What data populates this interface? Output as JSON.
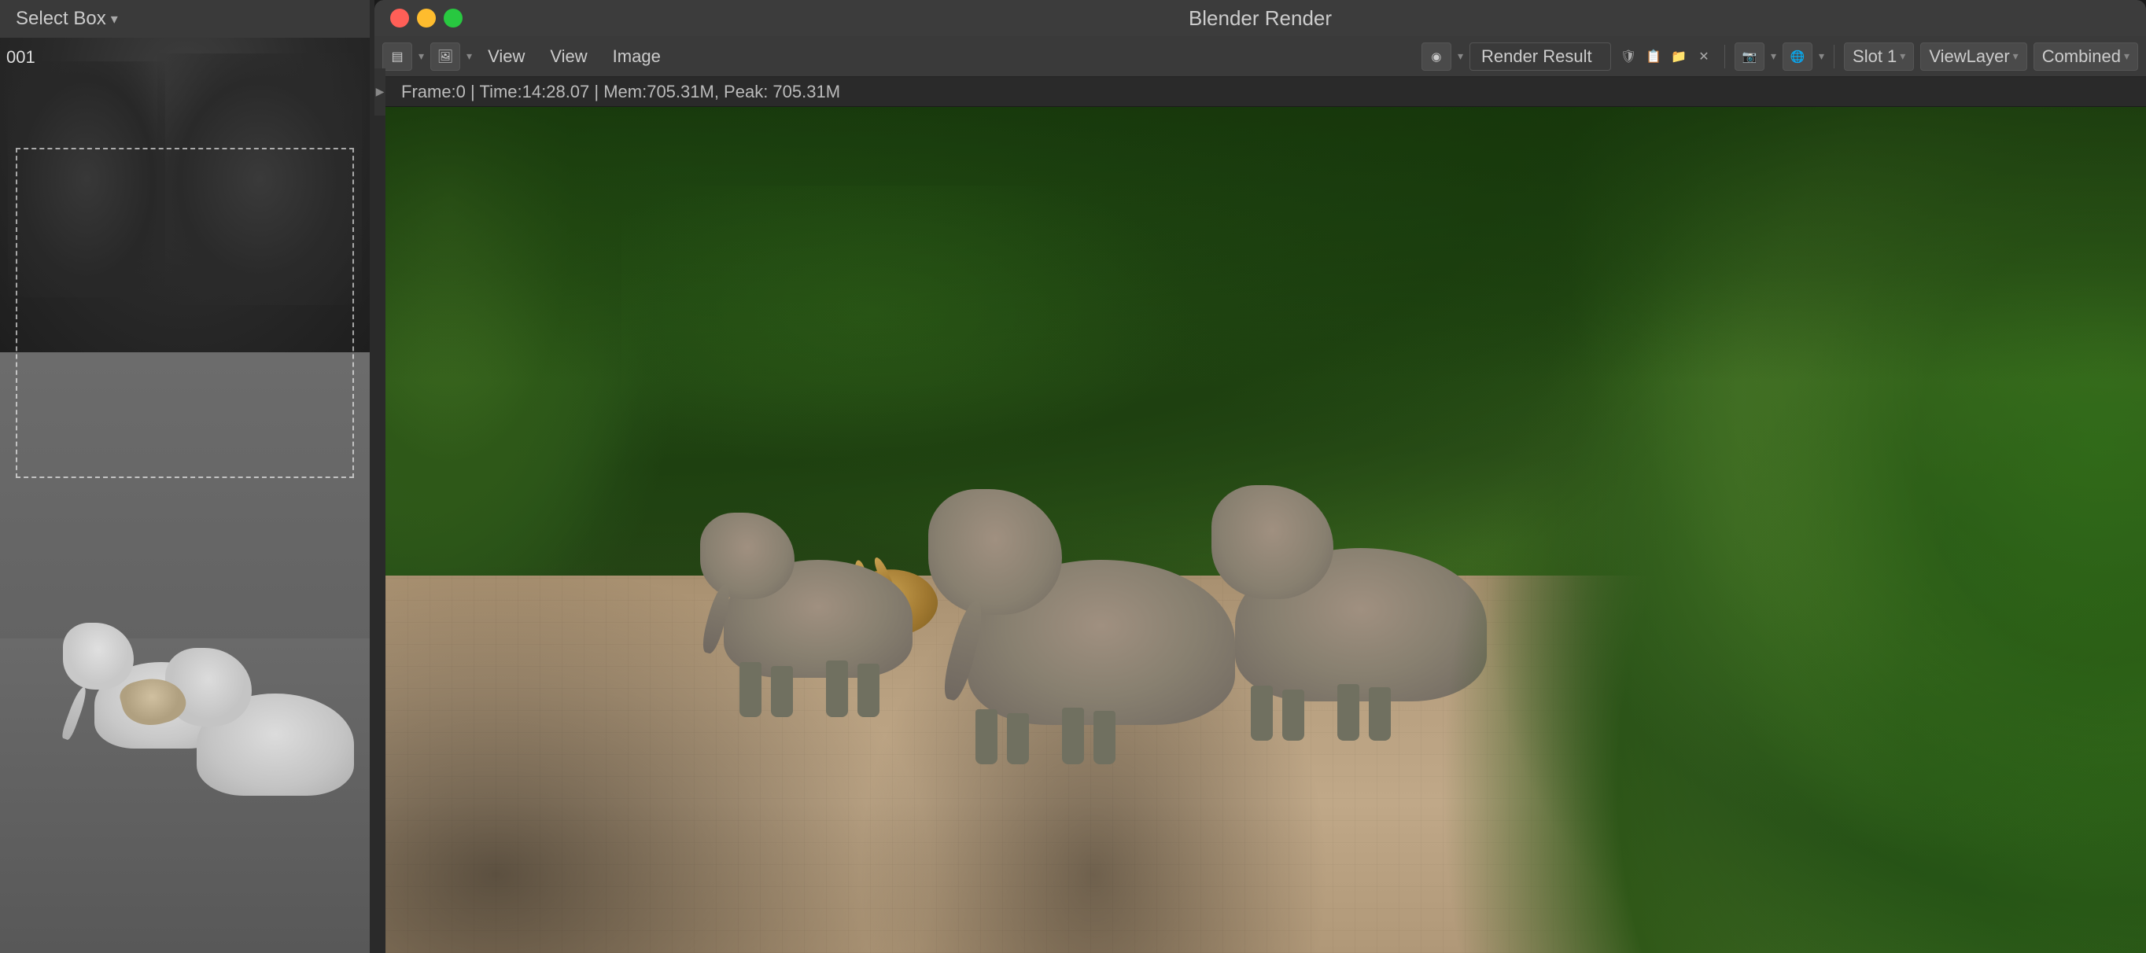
{
  "left_panel": {
    "toolbar": {
      "select_box_label": "Select Box",
      "chevron": "▾"
    },
    "scene_label": "001"
  },
  "blender_window": {
    "title": "Blender Render",
    "controls": {
      "close": "●",
      "minimize": "●",
      "maximize": "●"
    },
    "toolbar": {
      "view_icon": "🖼",
      "view_btn": "View",
      "view2_btn": "View",
      "image_btn": "Image",
      "render_result": "Render Result",
      "slot_label": "Slot 1",
      "view_layer_label": "ViewLayer",
      "combined_label": "Combined"
    },
    "status_bar": {
      "text": "Frame:0 | Time:14:28.07 | Mem:705.31M, Peak: 705.31M"
    }
  }
}
